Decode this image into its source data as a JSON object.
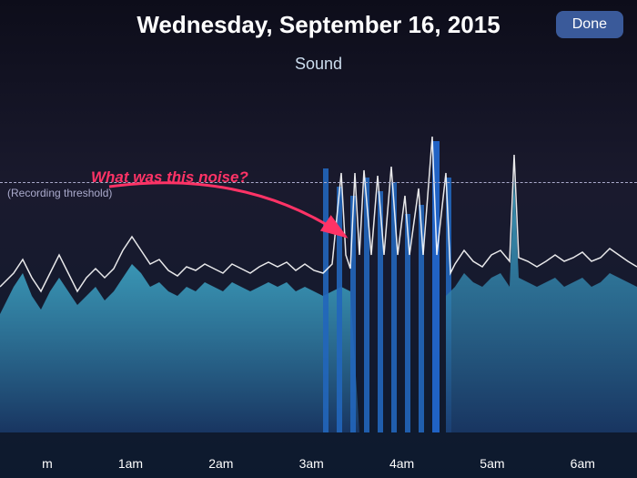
{
  "header": {
    "title": "Wednesday, September 16, 2015",
    "done_button": "Done"
  },
  "chart": {
    "title": "Sound",
    "threshold_label": "(Recording threshold)",
    "annotation_text": "What was this noise?",
    "x_labels": [
      "m",
      "1am",
      "2am",
      "3am",
      "4am",
      "5am",
      "6am"
    ]
  },
  "colors": {
    "background_top": "#0d0d1a",
    "background_bottom": "#0d1a2e",
    "area_fill_light": "#44bbdd",
    "area_fill_dark": "#1a4a88",
    "spike_color": "#2266cc",
    "line_color": "#ffffff",
    "threshold_line": "#aaaacc",
    "annotation_color": "#ff3366"
  }
}
